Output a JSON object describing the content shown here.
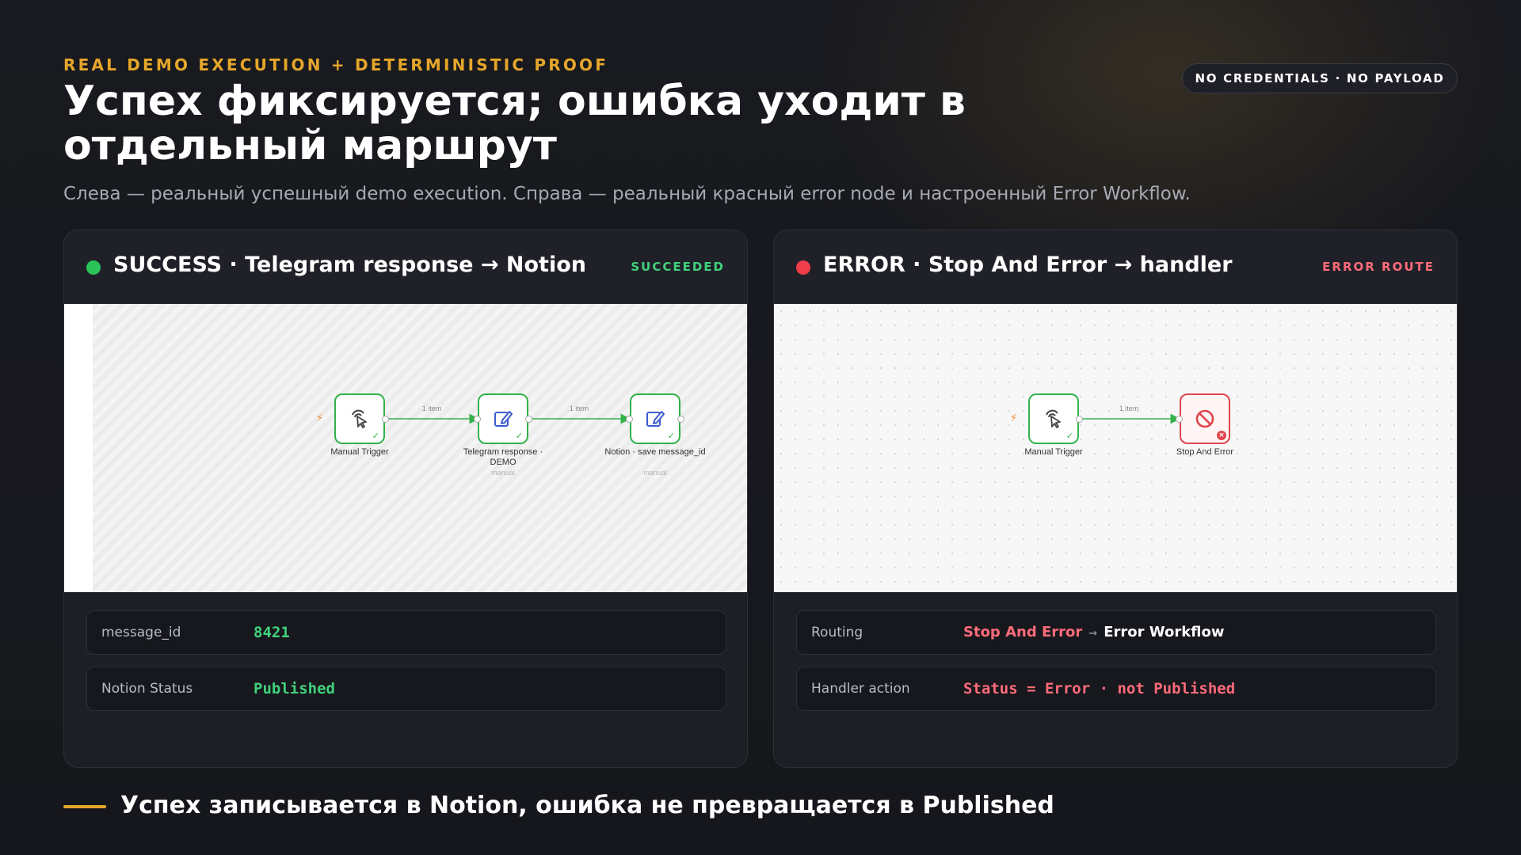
{
  "header": {
    "eyebrow": "REAL DEMO EXECUTION + DETERMINISTIC PROOF",
    "badge": "NO CREDENTIALS · NO PAYLOAD",
    "title": "Успех фиксируется; ошибка уходит в отдельный маршрут",
    "subtitle": "Слева — реальный успешный demo execution. Справа — реальный красный error node и настроенный Error Workflow."
  },
  "success_panel": {
    "title": "SUCCESS · Telegram response → Notion",
    "status": "SUCCEEDED",
    "status_color": "#41d27c",
    "canvas": {
      "nodes": [
        {
          "label": "Manual Trigger",
          "sub": "",
          "icon": "cursor-click-icon"
        },
        {
          "label": "Telegram response · DEMO",
          "sub": "manual",
          "icon": "edit-icon"
        },
        {
          "label": "Notion · save message_id",
          "sub": "manual",
          "icon": "edit-icon"
        }
      ],
      "edges": [
        {
          "label": "1 item"
        },
        {
          "label": "1 item"
        }
      ]
    },
    "rows": [
      {
        "key": "message_id",
        "value": "8421"
      },
      {
        "key": "Notion Status",
        "value": "Published"
      }
    ]
  },
  "error_panel": {
    "title": "ERROR · Stop And Error → handler",
    "status": "ERROR ROUTE",
    "status_color": "#ff6b7a",
    "canvas": {
      "nodes": [
        {
          "label": "Manual Trigger",
          "icon": "cursor-click-icon"
        },
        {
          "label": "Stop And Error",
          "icon": "prohibited-icon"
        }
      ],
      "edges": [
        {
          "label": "1 item"
        }
      ]
    },
    "routing": {
      "key": "Routing",
      "from": "Stop And Error",
      "arrow": "→",
      "to": "Error Workflow"
    },
    "handler": {
      "key": "Handler action",
      "value": "Status = Error · not Published"
    }
  },
  "footer": {
    "text": "Успех записывается в Notion, ошибка не превращается в Published"
  },
  "colors": {
    "accent": "#e5a62a",
    "success": "#41d27c",
    "error": "#ff6b7a",
    "node_success_border": "#33b24a",
    "node_error_border": "#e0454d"
  }
}
